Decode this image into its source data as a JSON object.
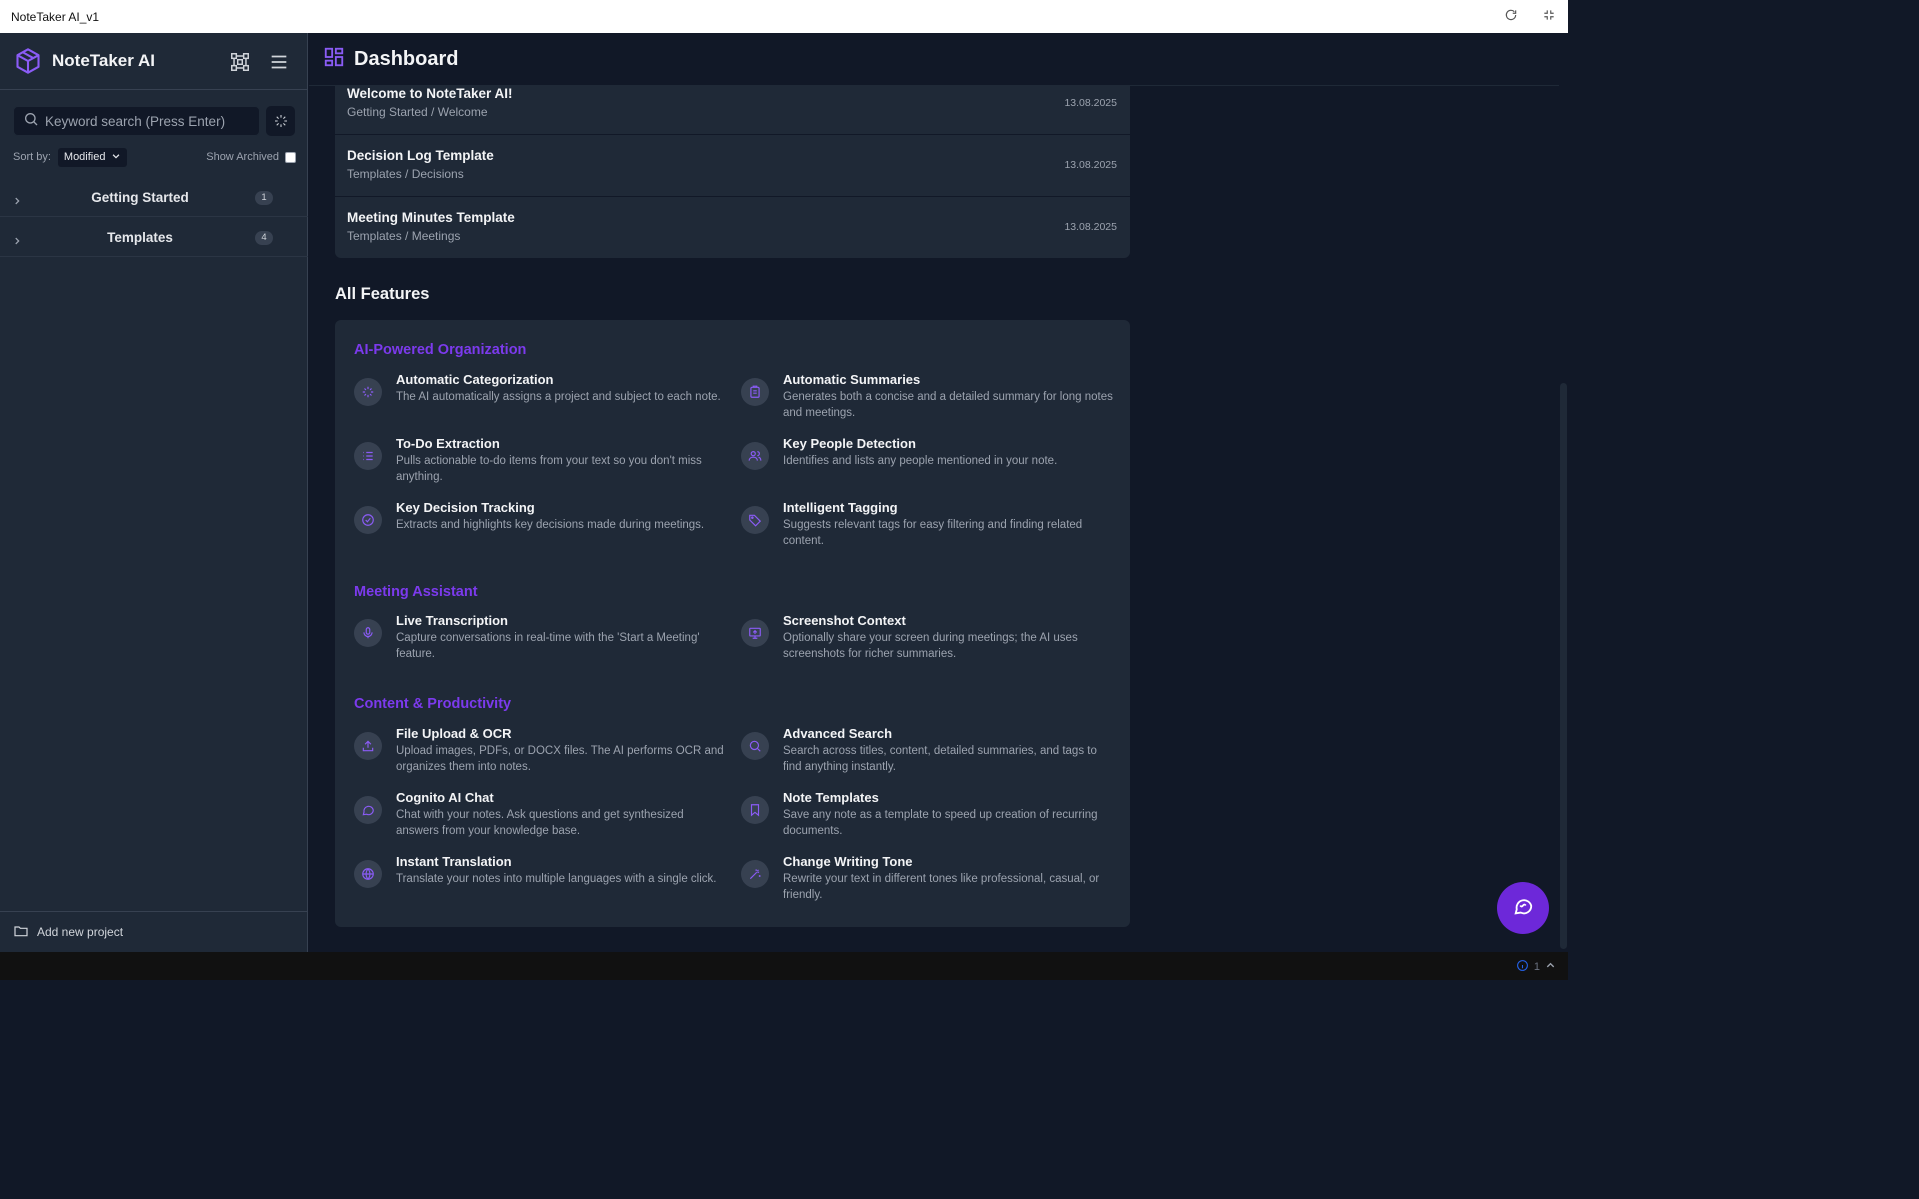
{
  "window": {
    "title": "NoteTaker AI_v1"
  },
  "sidebar": {
    "brand": "NoteTaker AI",
    "search": {
      "placeholder": "Keyword search (Press Enter)",
      "value": ""
    },
    "sort": {
      "label": "Sort by:",
      "selected": "Modified"
    },
    "show_archived_label": "Show Archived",
    "projects": [
      {
        "name": "Getting Started",
        "count": "1"
      },
      {
        "name": "Templates",
        "count": "4"
      }
    ],
    "add_project_label": "Add new project"
  },
  "main": {
    "title": "Dashboard",
    "recent_notes": [
      {
        "title": "Welcome to NoteTaker AI!",
        "path": "Getting Started / Welcome",
        "date": "13.08.2025"
      },
      {
        "title": "Decision Log Template",
        "path": "Templates / Decisions",
        "date": "13.08.2025"
      },
      {
        "title": "Meeting Minutes Template",
        "path": "Templates / Meetings",
        "date": "13.08.2025"
      }
    ],
    "all_features_title": "All Features",
    "sections": [
      {
        "title": "AI-Powered Organization"
      },
      {
        "title": "Meeting Assistant"
      },
      {
        "title": "Content & Productivity"
      }
    ],
    "features": [
      {
        "icon": "sparkle-icon",
        "title": "Automatic Categorization",
        "desc": "The AI automatically assigns a project and subject to each note."
      },
      {
        "icon": "clipboard-icon",
        "title": "Automatic Summaries",
        "desc": "Generates both a concise and a detailed summary for long notes and meetings."
      },
      {
        "icon": "list-icon",
        "title": "To-Do Extraction",
        "desc": "Pulls actionable to-do items from your text so you don't miss anything."
      },
      {
        "icon": "people-icon",
        "title": "Key People Detection",
        "desc": "Identifies and lists any people mentioned in your note."
      },
      {
        "icon": "check-circle-icon",
        "title": "Key Decision Tracking",
        "desc": "Extracts and highlights key decisions made during meetings."
      },
      {
        "icon": "tag-icon",
        "title": "Intelligent Tagging",
        "desc": "Suggests relevant tags for easy filtering and finding related content."
      },
      {
        "icon": "microphone-icon",
        "title": "Live Transcription",
        "desc": "Capture conversations in real-time with the 'Start a Meeting' feature."
      },
      {
        "icon": "screen-share-icon",
        "title": "Screenshot Context",
        "desc": "Optionally share your screen during meetings; the AI uses screenshots for richer summaries."
      },
      {
        "icon": "upload-icon",
        "title": "File Upload & OCR",
        "desc": "Upload images, PDFs, or DOCX files. The AI performs OCR and organizes them into notes."
      },
      {
        "icon": "search-icon",
        "title": "Advanced Search",
        "desc": "Search across titles, content, detailed summaries, and tags to find anything instantly."
      },
      {
        "icon": "chat-bubble-icon",
        "title": "Cognito AI Chat",
        "desc": "Chat with your notes. Ask questions and get synthesized answers from your knowledge base."
      },
      {
        "icon": "bookmark-icon",
        "title": "Note Templates",
        "desc": "Save any note as a template to speed up creation of recurring documents."
      },
      {
        "icon": "globe-icon",
        "title": "Instant Translation",
        "desc": "Translate your notes into multiple languages with a single click."
      },
      {
        "icon": "magic-wand-icon",
        "title": "Change Writing Tone",
        "desc": "Rewrite your text in different tones like professional, casual, or friendly."
      }
    ]
  },
  "statusbar": {
    "info_count": "1"
  },
  "colors": {
    "accent": "#7c3aed",
    "sidebar_bg": "#1f2937",
    "main_bg": "#111827"
  }
}
